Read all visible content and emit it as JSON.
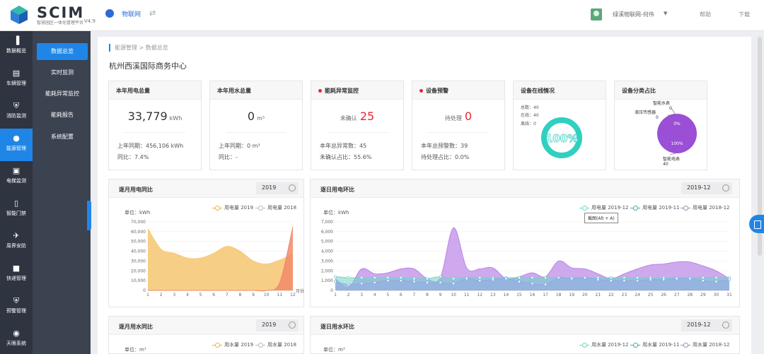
{
  "app": {
    "name": "SCIM",
    "subtitle": "智慧园区一体化管理平台",
    "version": "V4.9"
  },
  "header": {
    "platform_label": "物联网",
    "user_label": "绿溪物联网-何伟",
    "help_label": "帮助",
    "download_label": "下载"
  },
  "rail": {
    "items": [
      {
        "label": "数据概览",
        "icon": "bar-chart-icon"
      },
      {
        "label": "车辆管理",
        "icon": "car-doc-icon"
      },
      {
        "label": "消防监测",
        "icon": "shield-icon"
      },
      {
        "label": "能源管理",
        "icon": "drop-icon",
        "active": true
      },
      {
        "label": "电梯监测",
        "icon": "elevator-icon"
      },
      {
        "label": "智能门禁",
        "icon": "door-icon"
      },
      {
        "label": "周界安防",
        "icon": "satellite-icon"
      },
      {
        "label": "快递管理",
        "icon": "box-icon"
      },
      {
        "label": "预警管理",
        "icon": "alert-shield-icon"
      },
      {
        "label": "天眼系统",
        "icon": "eye-icon"
      }
    ]
  },
  "submenu": {
    "items": [
      {
        "label": "数据总览",
        "active": true
      },
      {
        "label": "实时监测"
      },
      {
        "label": "能耗异常监控"
      },
      {
        "label": "能耗报告"
      },
      {
        "label": "系统配置"
      }
    ]
  },
  "breadcrumb": "能源管理 > 数据总览",
  "page_title": "杭州西溪国际商务中心",
  "cards": {
    "electricity": {
      "title": "本年用电总量",
      "value": "33,779",
      "unit": "kWh",
      "last_year": "上年同期：456,106 kWh",
      "yoy": "同比：7.4%"
    },
    "water": {
      "title": "本年用水总量",
      "value": "0",
      "unit": "m³",
      "last_year": "上年同期：0 m³",
      "yoy": "同比：-"
    },
    "anomaly": {
      "title": "能耗异常监控",
      "label": "未确认",
      "value": "25",
      "total": "本年总异常数：45",
      "ratio": "未确认占比：55.6%"
    },
    "warning": {
      "title": "设备预警",
      "label": "待处理",
      "value": "0",
      "total": "本年总预警数：39",
      "ratio": "待处理占比：0.0%"
    },
    "online": {
      "title": "设备在线情况",
      "total": "总数：40",
      "online": "在线：40",
      "offline": "离线：0",
      "percent": "100%",
      "ring_color": "#2fd0c0"
    },
    "category": {
      "title": "设备分类占比",
      "label_water": "智能水表",
      "label_water_val": "0",
      "label_pressure": "液压传感器",
      "label_pressure_val": "0",
      "label_meter": "智能电表",
      "label_meter_val": "40",
      "zero_pct": "0%",
      "full_pct": "100%",
      "pie_color": "#9a4fd6"
    }
  },
  "panels": {
    "monthly_elec": {
      "title": "逐月用电同比",
      "select": "2019",
      "unit": "单位：kWh",
      "legend_a": "用电量 2019",
      "legend_b": "用电量 2018",
      "x_suffix": "月份"
    },
    "daily_elec": {
      "title": "逐日用电环比",
      "select": "2019-12",
      "unit": "单位：kWh",
      "legend_a": "用电量 2019-12",
      "legend_b": "用电量 2019-11",
      "legend_c": "用电量 2018-12",
      "tooltip": "截图(Alt + A)"
    },
    "monthly_water": {
      "title": "逐月用水同比",
      "select": "2019",
      "unit": "单位：m³",
      "legend_a": "用水量 2019",
      "legend_b": "用水量 2018"
    },
    "daily_water": {
      "title": "逐日用水环比",
      "select": "2019-12",
      "unit": "单位：m³",
      "legend_a": "用水量 2019-12",
      "legend_b": "用水量 2019-11",
      "legend_c": "用水量 2018-12"
    }
  },
  "chart_data": [
    {
      "type": "area",
      "title": "逐月用电同比",
      "xlabel": "月份",
      "ylabel": "单位：kWh",
      "x": [
        1,
        2,
        3,
        4,
        5,
        6,
        7,
        8,
        9,
        10,
        11,
        12
      ],
      "ylim": [
        0,
        70000
      ],
      "yticks": [
        0,
        10000,
        20000,
        30000,
        40000,
        50000,
        60000,
        70000
      ],
      "series": [
        {
          "name": "用电量 2019",
          "color": "#f6c978",
          "values": [
            63000,
            42000,
            38000,
            33000,
            33000,
            38000,
            45000,
            40000,
            30000,
            27000,
            31000,
            37000
          ]
        },
        {
          "name": "用电量 2018",
          "color": "#f28a6a",
          "values": [
            0,
            0,
            0,
            0,
            0,
            0,
            0,
            0,
            0,
            0,
            8000,
            65000
          ]
        }
      ]
    },
    {
      "type": "area",
      "title": "逐日用电环比",
      "ylabel": "单位：kWh",
      "x": [
        1,
        2,
        3,
        4,
        5,
        6,
        7,
        8,
        9,
        10,
        11,
        12,
        13,
        14,
        15,
        16,
        17,
        18,
        19,
        20,
        21,
        22,
        23,
        24,
        25,
        26,
        27,
        28,
        29,
        30,
        31
      ],
      "ylim": [
        0,
        7000
      ],
      "yticks": [
        0,
        1000,
        2000,
        3000,
        4000,
        5000,
        6000,
        7000
      ],
      "series": [
        {
          "name": "用电量 2019-12",
          "color": "#b985e6",
          "values": [
            1200,
            300,
            2200,
            1700,
            1800,
            2200,
            2200,
            1200,
            1300,
            6400,
            2300,
            2200,
            2300,
            1200,
            1400,
            1800,
            1400,
            3000,
            2300,
            2200,
            1700,
            1200,
            1700,
            2200,
            2600,
            2700,
            2900,
            2900,
            2500,
            2000,
            1200
          ]
        },
        {
          "name": "用电量 2019-11",
          "color": "#6fd3c6",
          "values": [
            1400,
            1300,
            1300,
            1300,
            1300,
            1300,
            1200,
            1200,
            1400,
            1200,
            1300,
            1300,
            1300,
            1300,
            1300,
            1300,
            1300,
            1300,
            1300,
            1300,
            1300,
            1300,
            1300,
            1300,
            1300,
            1300,
            1300,
            1300,
            1300,
            1300,
            1300
          ]
        },
        {
          "name": "用电量 2018-12",
          "color": "#8fa8e8",
          "values": [
            900,
            600,
            700,
            800,
            1000,
            1000,
            900,
            800,
            800,
            700,
            1200,
            1000,
            1100,
            1200,
            900,
            700,
            600,
            1300,
            1200,
            1300,
            1100,
            1000,
            1000,
            1000,
            1100,
            1100,
            1200,
            1200,
            1000,
            900,
            1100
          ]
        }
      ]
    }
  ]
}
